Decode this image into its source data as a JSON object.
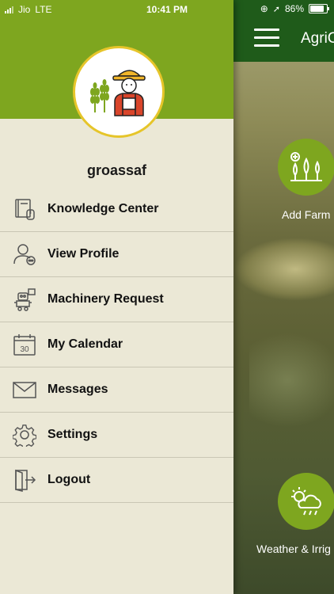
{
  "status_bar": {
    "carrier": "Jio",
    "network": "LTE",
    "time": "10:41 PM",
    "battery": "86%"
  },
  "app": {
    "title": "AgriC"
  },
  "tiles": [
    {
      "label": "Add Farm",
      "icon": "add-farm-icon"
    },
    {
      "label": "Weather & Irrig",
      "icon": "weather-icon"
    }
  ],
  "drawer": {
    "username": "groassaf",
    "items": [
      {
        "label": "Knowledge Center",
        "icon": "book-icon"
      },
      {
        "label": "View Profile",
        "icon": "profile-icon"
      },
      {
        "label": "Machinery Request",
        "icon": "robot-icon"
      },
      {
        "label": "My Calendar",
        "icon": "calendar-icon"
      },
      {
        "label": "Messages",
        "icon": "envelope-icon"
      },
      {
        "label": "Settings",
        "icon": "gear-icon"
      },
      {
        "label": "Logout",
        "icon": "logout-icon"
      }
    ]
  },
  "colors": {
    "header_green": "#7ea61f",
    "appbar_green": "#1f5b1a",
    "drawer_bg": "#ebe8d6",
    "avatar_ring": "#e6c52a"
  }
}
